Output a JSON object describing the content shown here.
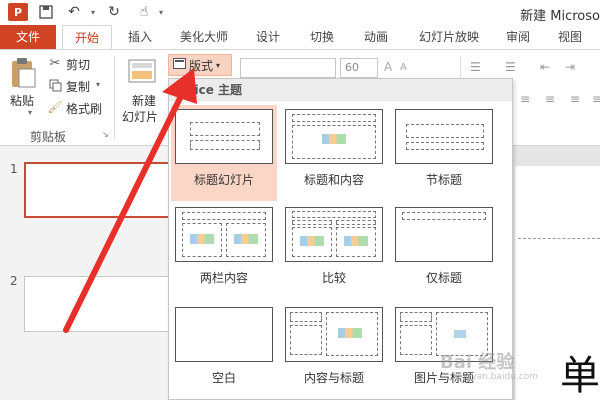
{
  "titlebar": {
    "window_title": "新建 Microso"
  },
  "tabs": [
    {
      "label": "文件"
    },
    {
      "label": "开始"
    },
    {
      "label": "插入"
    },
    {
      "label": "美化大师"
    },
    {
      "label": "设计"
    },
    {
      "label": "切换"
    },
    {
      "label": "动画"
    },
    {
      "label": "幻灯片放映"
    },
    {
      "label": "审阅"
    },
    {
      "label": "视图"
    }
  ],
  "ribbon": {
    "paste_label": "粘贴",
    "cut_label": "剪切",
    "copy_label": "复制",
    "format_painter_label": "格式刷",
    "clipboard_group_label": "剪贴板",
    "new_slide_line1": "新建",
    "new_slide_line2": "幻灯片",
    "layout_button_label": "版式",
    "font_size_value": "60"
  },
  "gallery": {
    "header": "Office 主题",
    "layouts": [
      {
        "label": "标题幻灯片"
      },
      {
        "label": "标题和内容"
      },
      {
        "label": "节标题"
      },
      {
        "label": "两栏内容"
      },
      {
        "label": "比较"
      },
      {
        "label": "仅标题"
      },
      {
        "label": "空白"
      },
      {
        "label": "内容与标题"
      },
      {
        "label": "图片与标题"
      }
    ]
  },
  "slides_panel": {
    "slide_numbers": [
      "1",
      "2"
    ]
  },
  "watermark": {
    "text": "Bai 经验",
    "sub": "jingyan.baidu.com"
  },
  "overlay_char": "单",
  "colors": {
    "accent": "#d04423",
    "arrow": "#e8302a",
    "selection": "#fbd5c5"
  }
}
